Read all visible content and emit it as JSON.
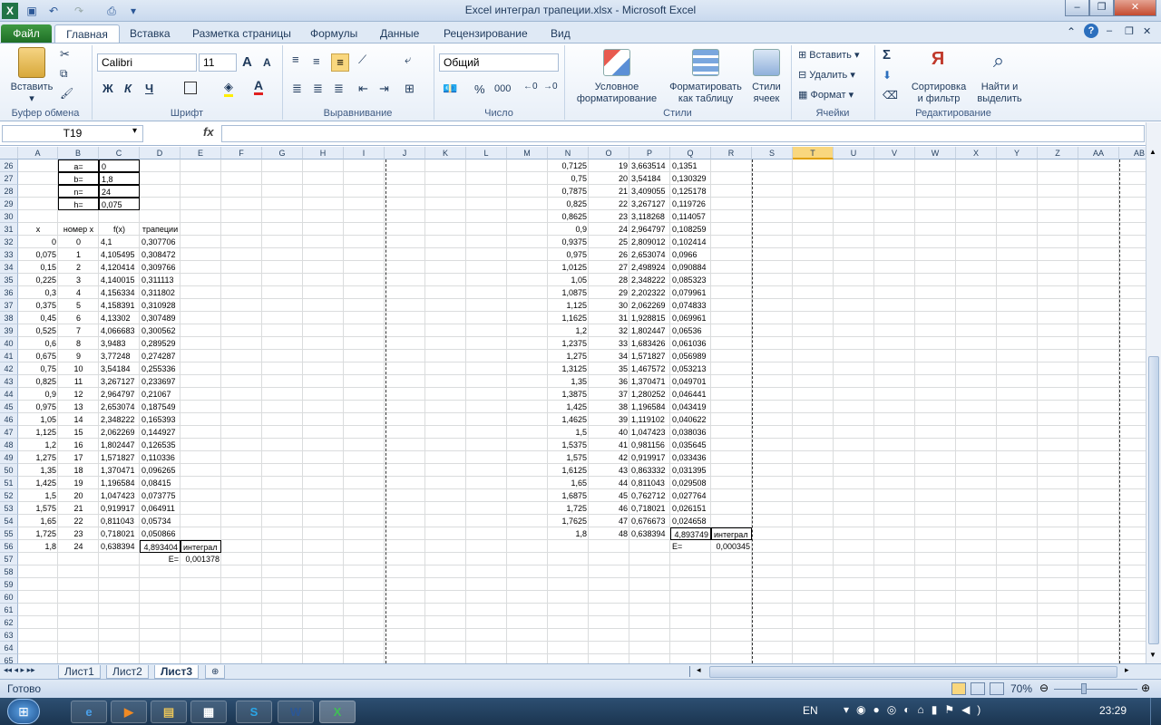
{
  "window": {
    "title": "Excel интеграл трапеции.xlsx  -  Microsoft Excel",
    "minimize": "–",
    "restore": "❐",
    "close": "✕"
  },
  "tabs": [
    "Файл",
    "Главная",
    "Вставка",
    "Разметка страницы",
    "Формулы",
    "Данные",
    "Рецензирование",
    "Вид"
  ],
  "ribbon": {
    "paste": "Вставить",
    "clipboard_group": "Буфер обмена",
    "font_name": "Calibri",
    "font_size": "11",
    "font_group": "Шрифт",
    "bold": "Ж",
    "italic": "К",
    "underline": "Ч",
    "align_group": "Выравнивание",
    "number_format": "Общий",
    "number_group": "Число",
    "percent": "%",
    "thousands": "000",
    "cond_format_1": "Условное",
    "cond_format_2": "форматирование",
    "format_table_1": "Форматировать",
    "format_table_2": "как таблицу",
    "cell_styles_1": "Стили",
    "cell_styles_2": "ячеек",
    "styles_group": "Стили",
    "insert": "Вставить",
    "delete": "Удалить",
    "format": "Формат",
    "cells_group": "Ячейки",
    "sort_1": "Сортировка",
    "sort_2": "и фильтр",
    "find_1": "Найти и",
    "find_2": "выделить",
    "edit_group": "Редактирование",
    "sigma": "Σ",
    "increase_font": "A",
    "decrease_font": "A"
  },
  "formula_bar": {
    "name_box": "T19",
    "fx": "fx",
    "value": ""
  },
  "columns": [
    "A",
    "B",
    "C",
    "D",
    "E",
    "F",
    "G",
    "H",
    "I",
    "J",
    "K",
    "L",
    "M",
    "N",
    "O",
    "P",
    "Q",
    "R",
    "S",
    "T",
    "U",
    "V",
    "W",
    "X",
    "Y",
    "Z",
    "AA",
    "AB"
  ],
  "rows": [
    "26",
    "27",
    "28",
    "29",
    "30",
    "31",
    "32",
    "33",
    "34",
    "35",
    "36",
    "37",
    "38",
    "39",
    "40",
    "41",
    "42",
    "43",
    "44",
    "45",
    "46",
    "47",
    "48",
    "49",
    "50",
    "51",
    "52",
    "53",
    "54",
    "55",
    "56",
    "57",
    "58",
    "59",
    "60",
    "61",
    "62",
    "63",
    "64",
    "65"
  ],
  "params": {
    "a_label": "a=",
    "a_value": "0",
    "b_label": "b=",
    "b_value": "1,8",
    "n_label": "n=",
    "n_value": "24",
    "h_label": "h=",
    "h_value": "0,075"
  },
  "left_table": {
    "headers": [
      "x",
      "номер x",
      "f(x)",
      "трапеции"
    ],
    "rows": [
      [
        "0",
        "0",
        "4,1",
        "0,307706"
      ],
      [
        "0,075",
        "1",
        "4,105495",
        "0,308472"
      ],
      [
        "0,15",
        "2",
        "4,120414",
        "0,309766"
      ],
      [
        "0,225",
        "3",
        "4,140015",
        "0,311113"
      ],
      [
        "0,3",
        "4",
        "4,156334",
        "0,311802"
      ],
      [
        "0,375",
        "5",
        "4,158391",
        "0,310928"
      ],
      [
        "0,45",
        "6",
        "4,13302",
        "0,307489"
      ],
      [
        "0,525",
        "7",
        "4,066683",
        "0,300562"
      ],
      [
        "0,6",
        "8",
        "3,9483",
        "0,289529"
      ],
      [
        "0,675",
        "9",
        "3,77248",
        "0,274287"
      ],
      [
        "0,75",
        "10",
        "3,54184",
        "0,255336"
      ],
      [
        "0,825",
        "11",
        "3,267127",
        "0,233697"
      ],
      [
        "0,9",
        "12",
        "2,964797",
        "0,21067"
      ],
      [
        "0,975",
        "13",
        "2,653074",
        "0,187549"
      ],
      [
        "1,05",
        "14",
        "2,348222",
        "0,165393"
      ],
      [
        "1,125",
        "15",
        "2,062269",
        "0,144927"
      ],
      [
        "1,2",
        "16",
        "1,802447",
        "0,126535"
      ],
      [
        "1,275",
        "17",
        "1,571827",
        "0,110336"
      ],
      [
        "1,35",
        "18",
        "1,370471",
        "0,096265"
      ],
      [
        "1,425",
        "19",
        "1,196584",
        "0,08415"
      ],
      [
        "1,5",
        "20",
        "1,047423",
        "0,073775"
      ],
      [
        "1,575",
        "21",
        "0,919917",
        "0,064911"
      ],
      [
        "1,65",
        "22",
        "0,811043",
        "0,05734"
      ],
      [
        "1,725",
        "23",
        "0,718021",
        "0,050866"
      ],
      [
        "1,8",
        "24",
        "0,638394",
        ""
      ]
    ],
    "integral_value": "4,893404",
    "integral_label": "интеграл",
    "error_label": "E=",
    "error_value": "0,001378"
  },
  "right_table": {
    "rows": [
      [
        "0,7125",
        "19",
        "3,663514",
        "0,1351"
      ],
      [
        "0,75",
        "20",
        "3,54184",
        "0,130329"
      ],
      [
        "0,7875",
        "21",
        "3,409055",
        "0,125178"
      ],
      [
        "0,825",
        "22",
        "3,267127",
        "0,119726"
      ],
      [
        "0,8625",
        "23",
        "3,118268",
        "0,114057"
      ],
      [
        "0,9",
        "24",
        "2,964797",
        "0,108259"
      ],
      [
        "0,9375",
        "25",
        "2,809012",
        "0,102414"
      ],
      [
        "0,975",
        "26",
        "2,653074",
        "0,0966"
      ],
      [
        "1,0125",
        "27",
        "2,498924",
        "0,090884"
      ],
      [
        "1,05",
        "28",
        "2,348222",
        "0,085323"
      ],
      [
        "1,0875",
        "29",
        "2,202322",
        "0,079961"
      ],
      [
        "1,125",
        "30",
        "2,062269",
        "0,074833"
      ],
      [
        "1,1625",
        "31",
        "1,928815",
        "0,069961"
      ],
      [
        "1,2",
        "32",
        "1,802447",
        "0,06536"
      ],
      [
        "1,2375",
        "33",
        "1,683426",
        "0,061036"
      ],
      [
        "1,275",
        "34",
        "1,571827",
        "0,056989"
      ],
      [
        "1,3125",
        "35",
        "1,467572",
        "0,053213"
      ],
      [
        "1,35",
        "36",
        "1,370471",
        "0,049701"
      ],
      [
        "1,3875",
        "37",
        "1,280252",
        "0,046441"
      ],
      [
        "1,425",
        "38",
        "1,196584",
        "0,043419"
      ],
      [
        "1,4625",
        "39",
        "1,119102",
        "0,040622"
      ],
      [
        "1,5",
        "40",
        "1,047423",
        "0,038036"
      ],
      [
        "1,5375",
        "41",
        "0,981156",
        "0,035645"
      ],
      [
        "1,575",
        "42",
        "0,919917",
        "0,033436"
      ],
      [
        "1,6125",
        "43",
        "0,863332",
        "0,031395"
      ],
      [
        "1,65",
        "44",
        "0,811043",
        "0,029508"
      ],
      [
        "1,6875",
        "45",
        "0,762712",
        "0,027764"
      ],
      [
        "1,725",
        "46",
        "0,718021",
        "0,026151"
      ],
      [
        "1,7625",
        "47",
        "0,676673",
        "0,024658"
      ],
      [
        "1,8",
        "48",
        "0,638394",
        ""
      ]
    ],
    "integral_value": "4,893749",
    "integral_label": "интеграл",
    "error_label": "E=",
    "error_value": "0,000345"
  },
  "sheets": [
    "Лист1",
    "Лист2",
    "Лист3"
  ],
  "status": {
    "ready": "Готово",
    "zoom": "70%"
  },
  "taskbar": {
    "lang": "EN",
    "time": "23:29"
  },
  "colors": {
    "file_tab": "#2e8b34",
    "ribbon_bg": "#dfe9f5",
    "selected_col": "#f9d77e",
    "taskbar": "#1b3550"
  }
}
